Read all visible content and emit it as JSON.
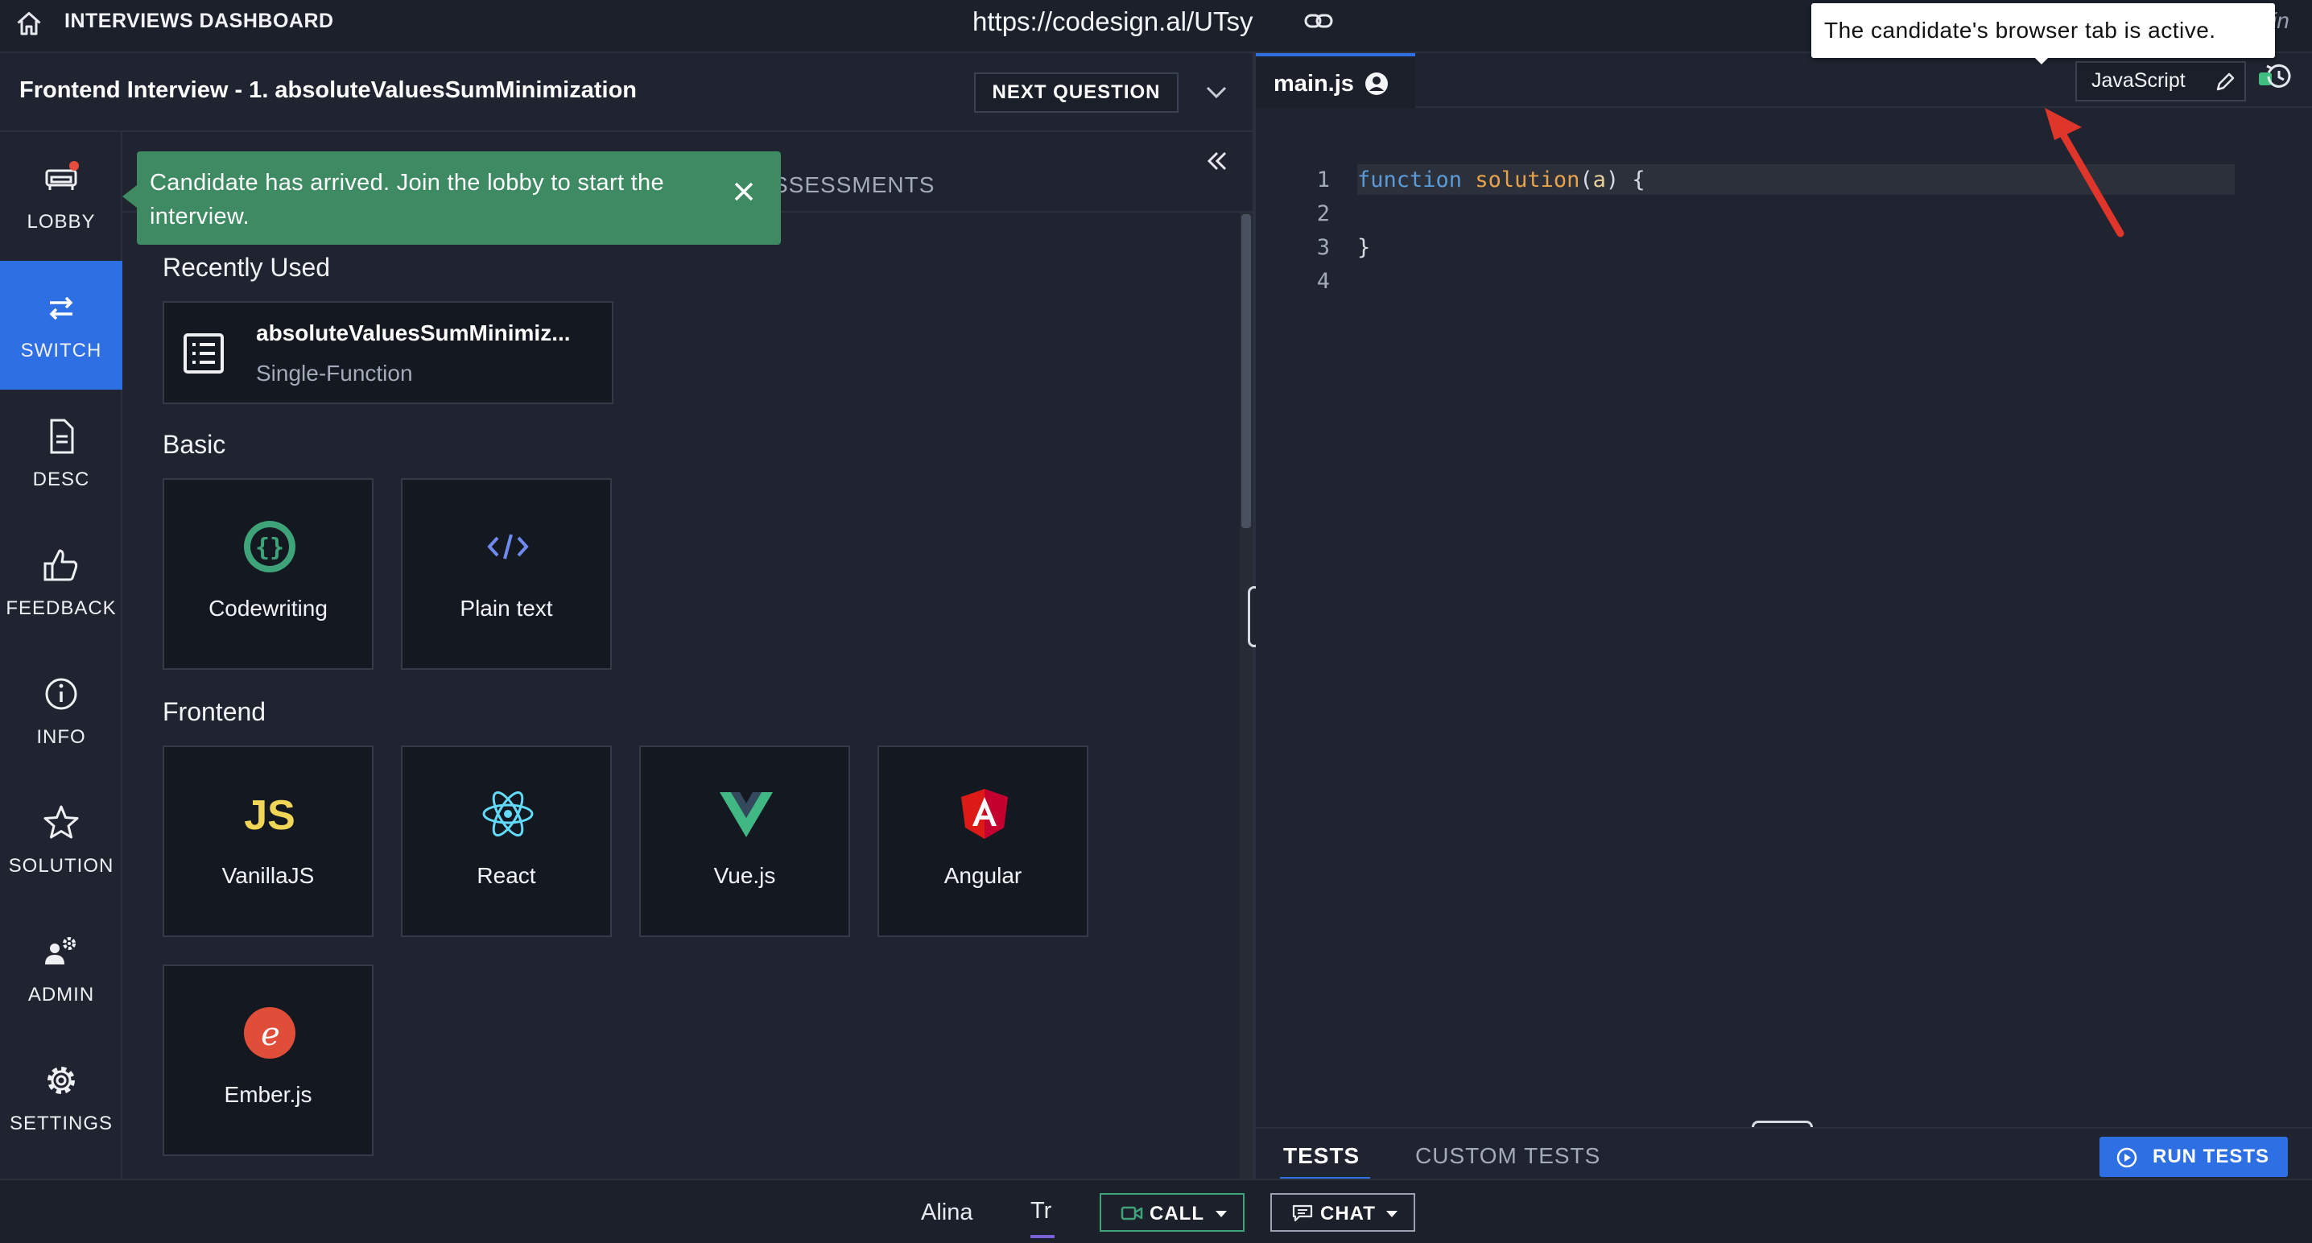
{
  "topbar": {
    "dashboard_label": "INTERVIEWS DASHBOARD",
    "url": "https://codesign.al/UTsy",
    "right_partial": "in"
  },
  "question": {
    "title": "Frontend Interview - 1. absoluteValuesSumMinimization",
    "next_label": "NEXT QUESTION"
  },
  "sidebar": {
    "items": [
      {
        "label": "LOBBY",
        "icon": "sofa-icon"
      },
      {
        "label": "SWITCH",
        "icon": "switch-arrows-icon"
      },
      {
        "label": "DESC",
        "icon": "document-icon"
      },
      {
        "label": "FEEDBACK",
        "icon": "thumbs-up-icon"
      },
      {
        "label": "INFO",
        "icon": "info-icon"
      },
      {
        "label": "SOLUTION",
        "icon": "star-icon"
      },
      {
        "label": "ADMIN",
        "icon": "admin-gear-icon"
      },
      {
        "label": "SETTINGS",
        "icon": "gear-icon"
      }
    ],
    "active_index": 1
  },
  "toast": {
    "message": "Candidate has arrived. Join the lobby to start the interview."
  },
  "content": {
    "assessments_tab": "SSESSMENTS",
    "recent_title": "Recently Used",
    "recent_item": {
      "title": "absoluteValuesSumMinimiz...",
      "subtitle": "Single-Function"
    },
    "basic_title": "Basic",
    "basic_items": [
      "Codewriting",
      "Plain text"
    ],
    "frontend_title": "Frontend",
    "frontend_items": [
      "VanillaJS",
      "React",
      "Vue.js",
      "Angular",
      "Ember.js"
    ]
  },
  "editor": {
    "file_name": "main.js",
    "language": "JavaScript",
    "line_numbers": [
      "1",
      "2",
      "3",
      "4"
    ],
    "code": {
      "keyword": "function",
      "name": "solution",
      "param": "a",
      "line1_open": "(",
      "line1_close": ") {",
      "line3": "}"
    }
  },
  "tooltip": {
    "text": "The candidate's browser tab is active."
  },
  "tests": {
    "tests_label": "TESTS",
    "custom_label": "CUSTOM TESTS",
    "run_label": "RUN TESTS"
  },
  "bottombar": {
    "user_name": "Alina",
    "user_initials": "Tr",
    "call_label": "CALL",
    "chat_label": "CHAT"
  },
  "colors": {
    "accent": "#2f6fe4",
    "toast": "#3d8a63",
    "active_dot": "#3fbf7f",
    "annotation_arrow": "#e0352b"
  }
}
